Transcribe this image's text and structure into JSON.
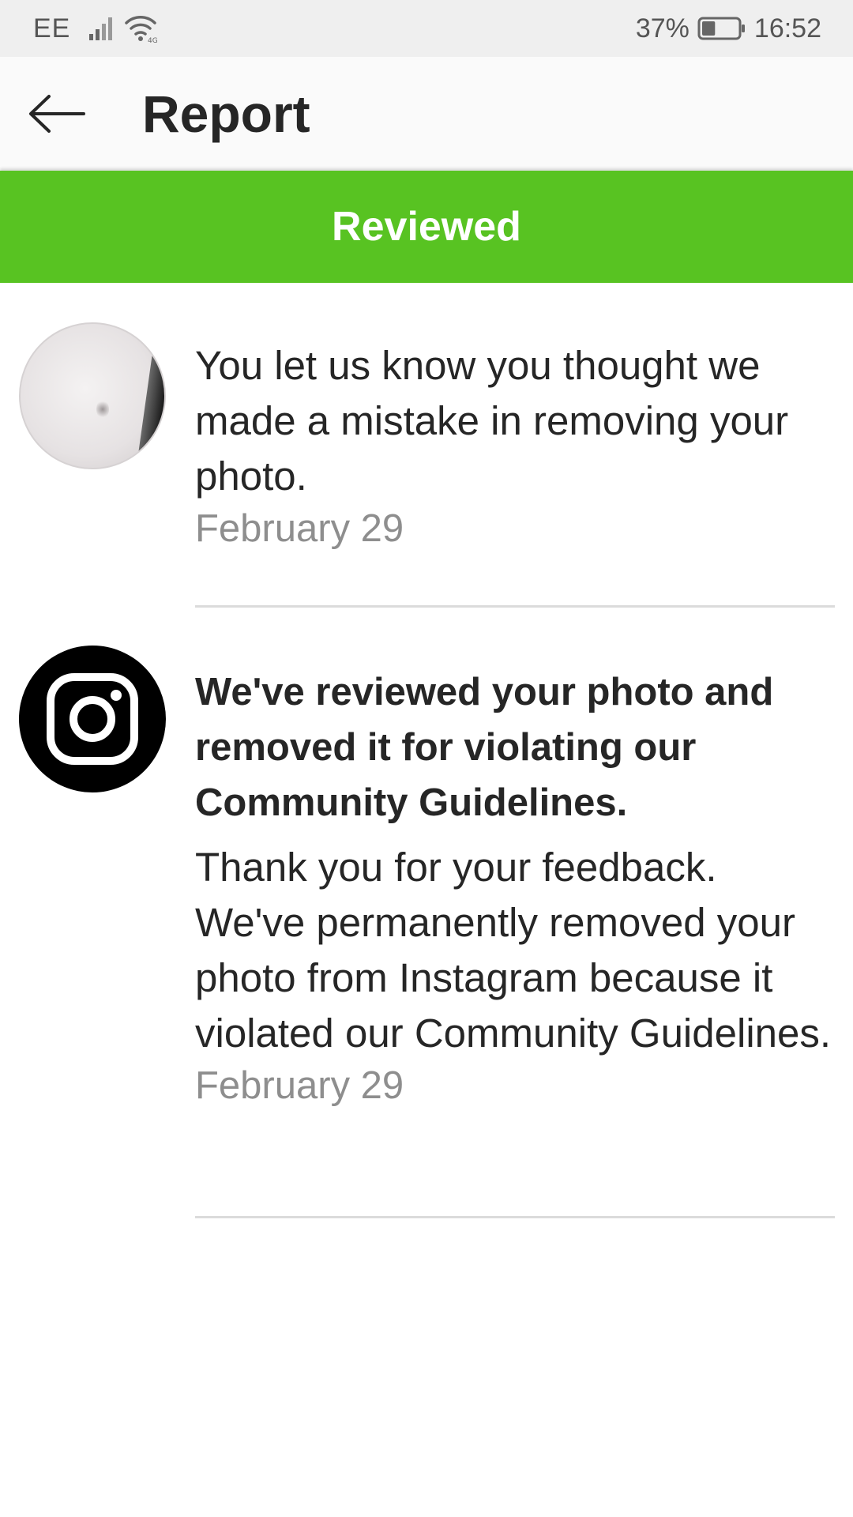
{
  "status_bar": {
    "carrier": "EE",
    "battery_percent": "37%",
    "battery_level": 0.37,
    "time": "16:52",
    "icons": [
      "signal-icon",
      "wifi-icon",
      "battery-icon"
    ]
  },
  "header": {
    "back_icon": "back-arrow-icon",
    "title": "Report"
  },
  "banner": {
    "label": "Reviewed",
    "color": "#58c322"
  },
  "items": [
    {
      "avatar": "reported-photo-thumbnail",
      "message": "You let us know you thought we made a mistake in removing your photo.",
      "date": "February 29"
    },
    {
      "avatar": "instagram-logo",
      "title": "We've reviewed your photo and removed it for violating our Community Guidelines.",
      "message": "Thank you for your feedback. We've permanently removed your photo from Instagram because it violated our Community Guidelines.",
      "date": "February 29"
    }
  ],
  "colors": {
    "text": "#262626",
    "secondary_text": "#8e8e8e",
    "divider": "#dbdbdb",
    "status_bar_bg": "#efefef",
    "header_bg": "#fafafa"
  }
}
